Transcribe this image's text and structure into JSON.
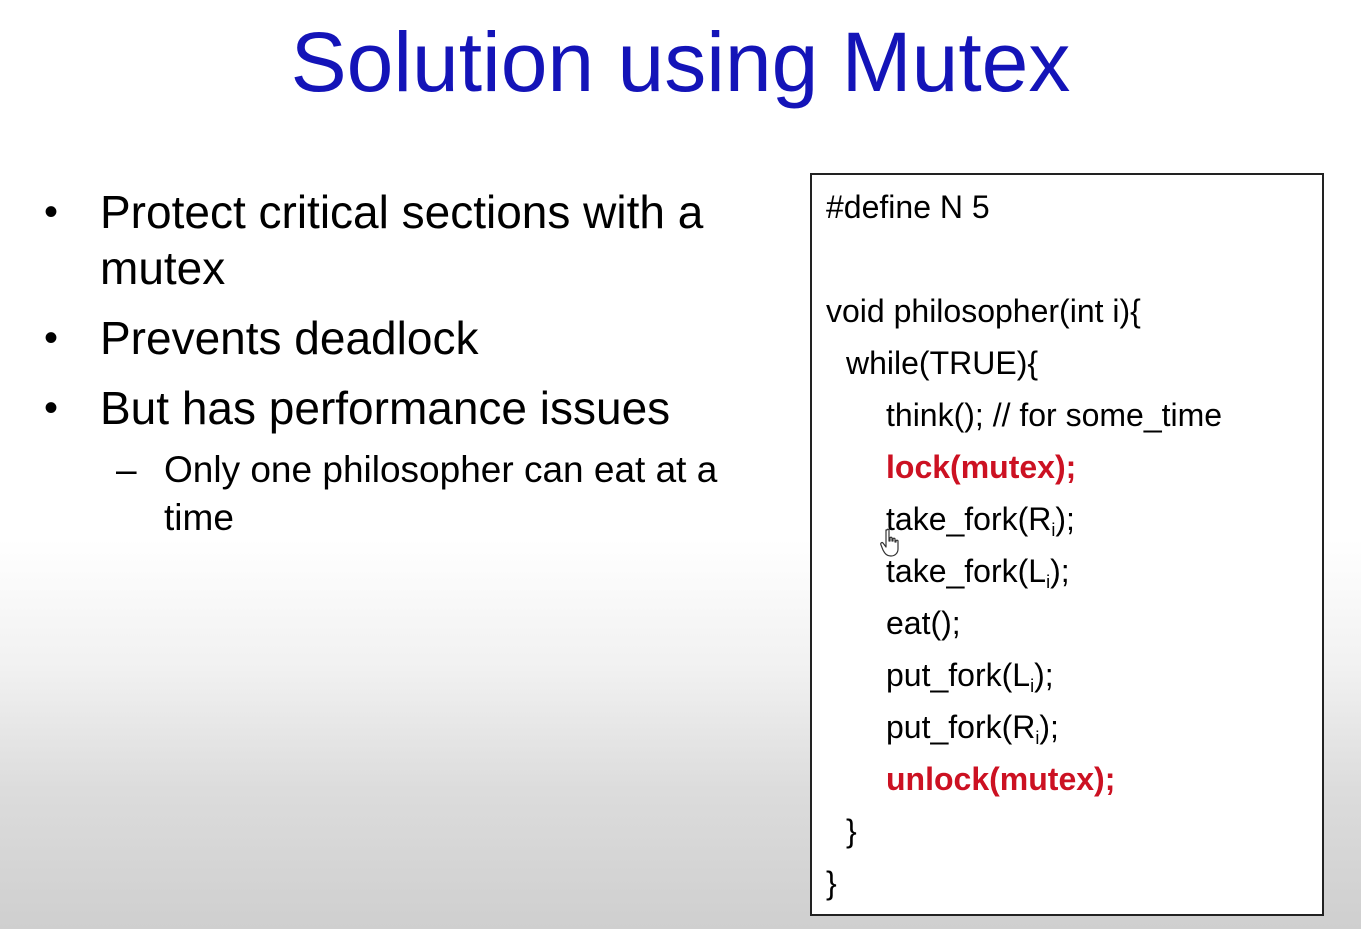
{
  "slide": {
    "title": "Solution using Mutex"
  },
  "bullets": [
    {
      "text": "Protect critical sections with a mutex"
    },
    {
      "text": "Prevents deadlock"
    },
    {
      "text": "But has performance issues"
    }
  ],
  "sub_bullets": [
    {
      "text": "Only one philosopher can eat at a time"
    }
  ],
  "bullet_glyph": "•",
  "dash_glyph": "–",
  "code": {
    "define": "#define N 5",
    "func_sig": "void philosopher(int i){",
    "while": "while(TRUE){",
    "think": "think(); // for some_time",
    "lock": "lock(mutex);",
    "take_fork_r_prefix": "take_fork(R",
    "take_fork_r_sub": "i",
    "take_fork_r_suffix": ");",
    "take_fork_l_prefix": "take_fork(L",
    "take_fork_l_sub": "i",
    "take_fork_l_suffix": ");",
    "eat": "eat();",
    "put_fork_l_prefix": "put_fork(L",
    "put_fork_l_sub": "i",
    "put_fork_l_suffix": ");",
    "put_fork_r_prefix": "put_fork(R",
    "put_fork_r_sub": "i",
    "put_fork_r_suffix": ");",
    "unlock": "unlock(mutex);",
    "close_while": "}",
    "close_func": "}"
  },
  "colors": {
    "title": "#1414b8",
    "highlight": "#cc1122"
  }
}
